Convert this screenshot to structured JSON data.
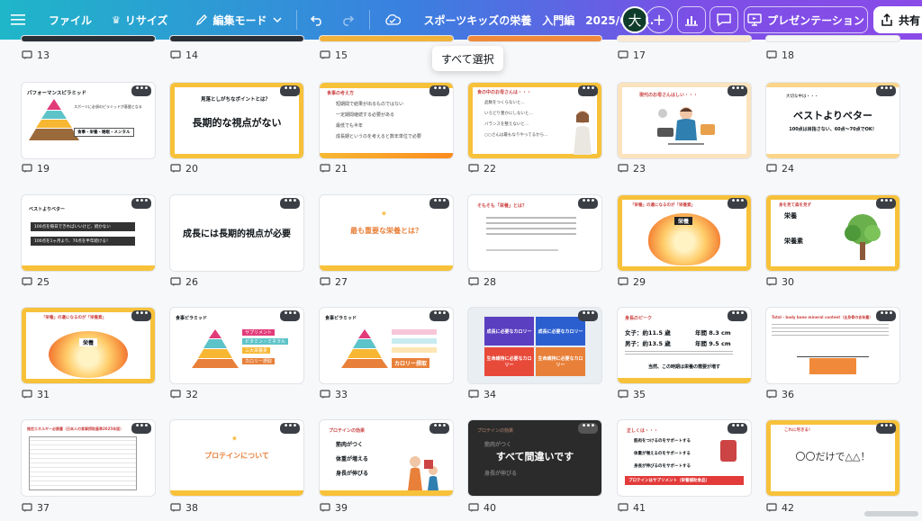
{
  "topbar": {
    "menu_icon": "hamburger-icon",
    "file": "ファイル",
    "resize": "リサイズ",
    "edit_mode": "編集モード",
    "title": "スポーツキッズの栄養　入門編　2025/6 無...",
    "avatar": "大",
    "present": "プレゼンテーション",
    "share": "共有"
  },
  "tooltip": "すべて選択",
  "slides": [
    {
      "n": "13"
    },
    {
      "n": "14"
    },
    {
      "n": "15"
    },
    {
      "n": "17"
    },
    {
      "n": "18"
    },
    {
      "n": "19",
      "title": "パフォーマンスピラミッド",
      "caption": "スポーツに必須のピラミッドが基盤となる",
      "label": "食事・栄養・睡眠・メンタル"
    },
    {
      "n": "20",
      "subtitle": "見落としがちなポイントとは？",
      "main": "長期的な視点がない"
    },
    {
      "n": "21",
      "title": "食事の考え方",
      "bullets": [
        "短期間で結果が出るものではない",
        "一定期間継続する必要がある",
        "最低でも半年",
        "成長期というのを考えると数年単位で必要"
      ]
    },
    {
      "n": "22",
      "title": "食の中のお母さんは・・・",
      "bullets": [
        "品数をつくらないと...",
        "いろどり豊かにしないと...",
        "バランスを整えないと...",
        "○○さんは最もなりやってるから..."
      ]
    },
    {
      "n": "23",
      "title": "現代のお母さんはしい・・・"
    },
    {
      "n": "24",
      "title": "大切な中は・・・",
      "main": "ベストよりベター",
      "sub": "100点は目指さない、60点〜70点でOK！"
    },
    {
      "n": "25",
      "title": "ベストよりベター",
      "line1": "100点を毎日できればいいけど、続かない",
      "line2": "100点を1ヶ月より、70点を半年続ける！"
    },
    {
      "n": "26",
      "main": "成長には長期的視点が必要"
    },
    {
      "n": "27",
      "main": "最も重要な栄養とは？"
    },
    {
      "n": "28",
      "title": "そもそも「栄養」とは？"
    },
    {
      "n": "29",
      "title": "「栄養」の違になるのが「栄養素」",
      "center": "栄養"
    },
    {
      "n": "30",
      "title": "身を見て森を見ず",
      "t1": "栄養",
      "t2": "栄養素"
    },
    {
      "n": "31",
      "title": "「栄養」の違になるのが「栄養素」",
      "center": "栄養"
    },
    {
      "n": "32",
      "title": "食事ピラミッド",
      "levels": [
        "サプリメント",
        "ビタミン・ミネラル",
        "三大栄養素",
        "カロリー摂取"
      ]
    },
    {
      "n": "33",
      "title": "食事ピラミッド",
      "levels": [
        "",
        "",
        "",
        "カロリー摂取"
      ]
    },
    {
      "n": "34",
      "cells": [
        "成長に必要なカロリー",
        "成長に必要なカロリー",
        "生命維持に必要なカロリー",
        "生命維持に必要なカロリー"
      ]
    },
    {
      "n": "35",
      "title": "身長のピーク",
      "girl": "女子：約11.5 歳",
      "girl_h": "年間 8.3 cm",
      "boy": "男子：約13.5 歳",
      "boy_h": "年間 9.5 cm",
      "note": "当然、この時期は栄養の需要が増す"
    },
    {
      "n": "36",
      "title": "Total - body bone mineral content（全身骨の含有量）"
    },
    {
      "n": "37",
      "title": "推定エネルギー必要量（日本人の食事摂取基準2025年版）"
    },
    {
      "n": "38",
      "main": "プロテインについて"
    },
    {
      "n": "39",
      "title": "プロテインの効果",
      "bullets": [
        "筋肉がつく",
        "体重が増える",
        "身長が伸びる"
      ]
    },
    {
      "n": "40",
      "title": "プロテインの効果",
      "main": "すべて間違いです",
      "bullets": [
        "筋肉がつく",
        "体重が増える",
        "身長が伸びる"
      ]
    },
    {
      "n": "41",
      "title": "正しくは・・・",
      "bullets": [
        "筋肉をつけるのをサポートする",
        "体重が増えるのをサポートする",
        "身長が伸びるのをサポートする"
      ],
      "footer": "プロテインはサプリメント（栄養補助食品）"
    },
    {
      "n": "42",
      "title": "これに尽きる！",
      "main": "〇〇だけで△△！"
    }
  ]
}
